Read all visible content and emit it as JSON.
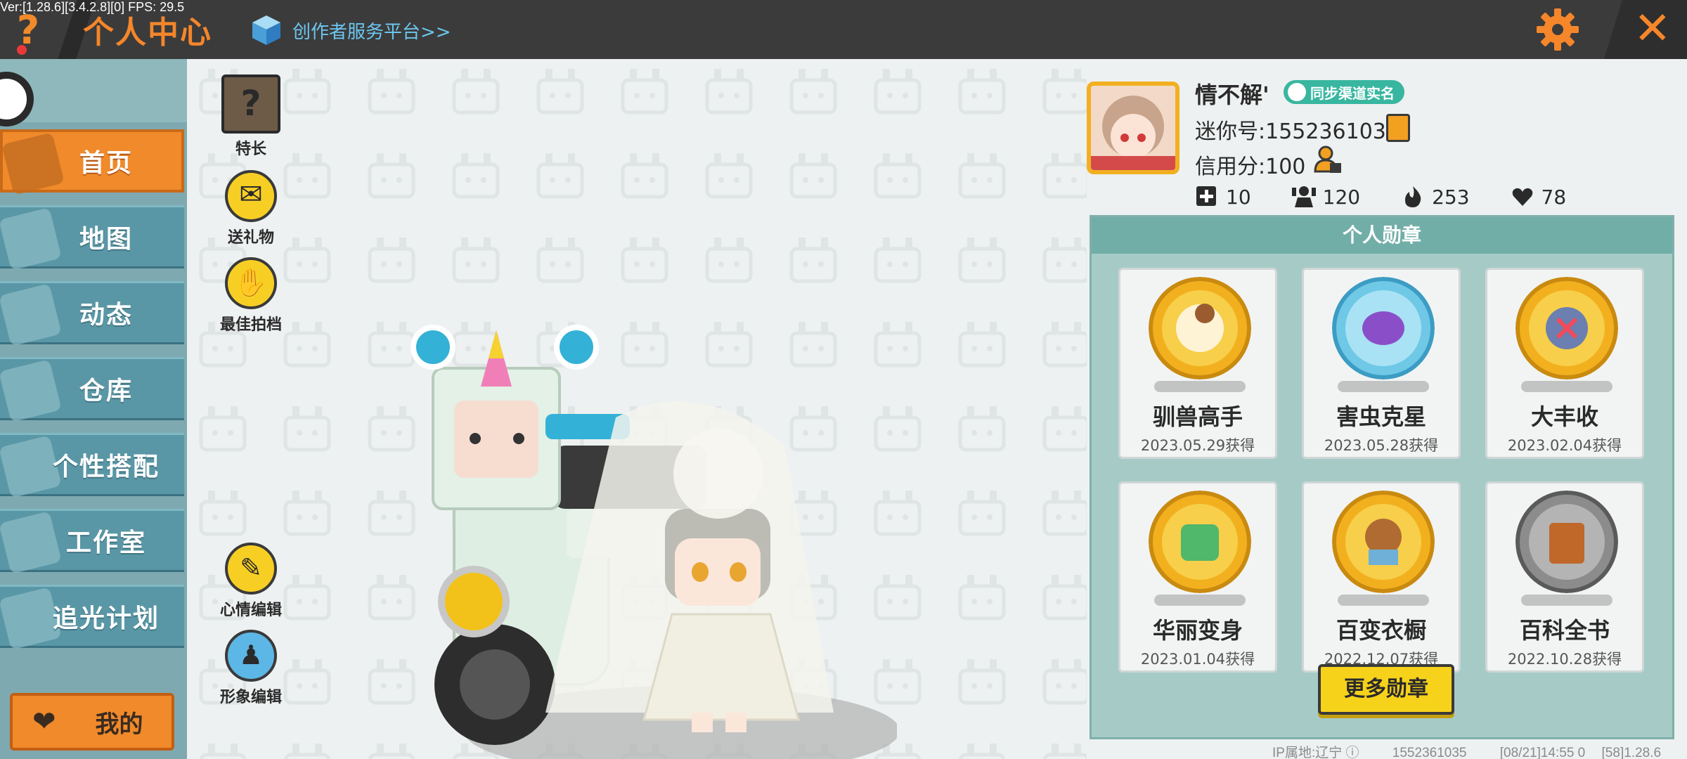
{
  "debug": {
    "fps_text": "Ver:[1.28.6][3.4.2.8][0] FPS: 29.5"
  },
  "header": {
    "title": "个人中心",
    "creator_platform": "创作者服务平台>>",
    "accent": "#f5862a"
  },
  "sidebar": {
    "items": [
      {
        "label": "首页",
        "icon": "house-icon",
        "active": true
      },
      {
        "label": "地图",
        "icon": "map-icon",
        "active": false
      },
      {
        "label": "动态",
        "icon": "bell-icon",
        "active": false
      },
      {
        "label": "仓库",
        "icon": "warehouse-icon",
        "active": false
      },
      {
        "label": "个性搭配",
        "icon": "wardrobe-icon",
        "active": false
      },
      {
        "label": "工作室",
        "icon": "studio-icon",
        "active": false
      },
      {
        "label": "追光计划",
        "icon": "spotlight-icon",
        "active": false
      }
    ],
    "mine_label": "我的"
  },
  "tools": {
    "specialty": "特长",
    "gift": "送礼物",
    "best_partner": "最佳拍档",
    "mood_edit": "心情编辑",
    "avatar_edit": "形象编辑"
  },
  "profile": {
    "name": "情不解'",
    "realname_badge": "同步渠道实名",
    "mini_id": "迷你号:1552361035",
    "credit": "信用分:100",
    "stats": [
      {
        "icon": "plus-flag-icon",
        "value": "10"
      },
      {
        "icon": "followers-icon",
        "value": "120"
      },
      {
        "icon": "flame-icon",
        "value": "253"
      },
      {
        "icon": "hearts-icon",
        "value": "78"
      }
    ]
  },
  "medals": {
    "title": "个人勋章",
    "items": [
      {
        "name": "驯兽高手",
        "date": "2023.05.29获得",
        "icon": "horse-monkey-medal-icon",
        "color": "#f2b01f"
      },
      {
        "name": "害虫克星",
        "date": "2023.05.28获得",
        "icon": "bug-medal-icon",
        "color": "#6ec8e6"
      },
      {
        "name": "大丰收",
        "date": "2023.02.04获得",
        "icon": "harvest-medal-icon",
        "color": "#f2b01f"
      },
      {
        "name": "华丽变身",
        "date": "2023.01.04获得",
        "icon": "dino-medal-icon",
        "color": "#f2b01f"
      },
      {
        "name": "百变衣橱",
        "date": "2022.12.07获得",
        "icon": "bear-medal-icon",
        "color": "#f2b01f"
      },
      {
        "name": "百科全书",
        "date": "2022.10.28获得",
        "icon": "book-medal-icon",
        "color": "#8c8c8c"
      }
    ],
    "more_label": "更多勋章"
  },
  "footer": {
    "ip": "IP属地:辽宁 ⓘ",
    "uid": "1552361035",
    "time": "[08/21]14:55 0",
    "version": "[58]1.28.6"
  }
}
